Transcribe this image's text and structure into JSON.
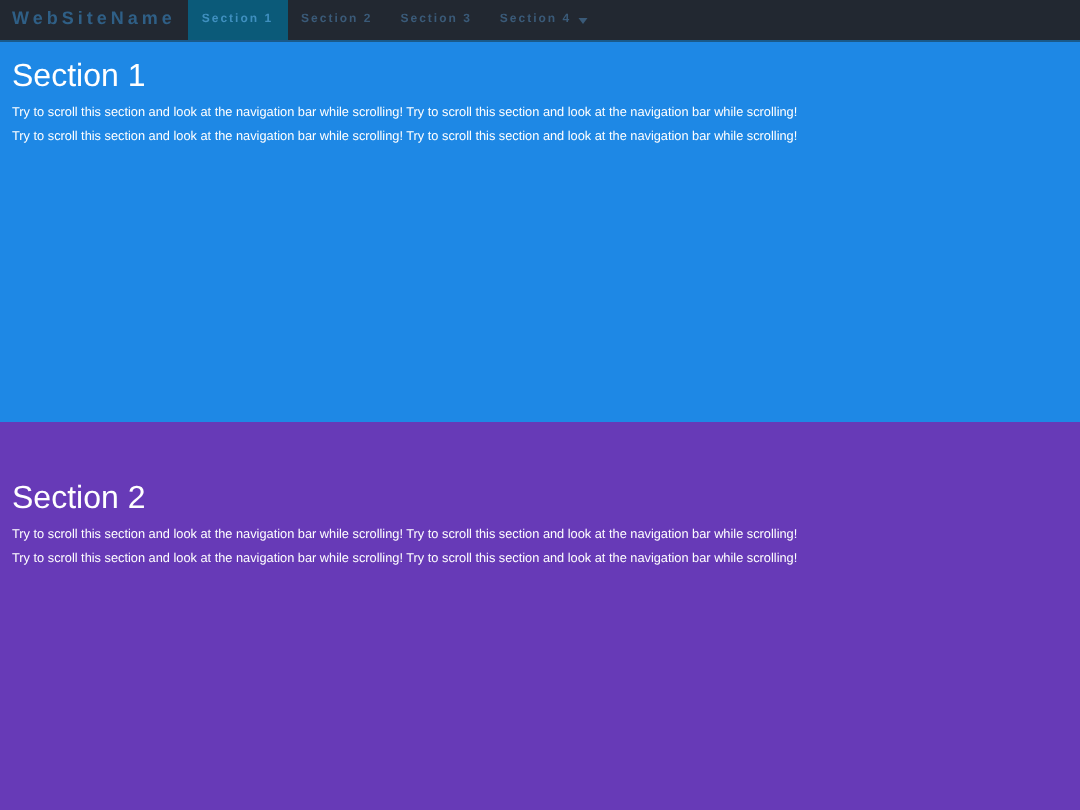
{
  "navbar": {
    "brand": "WebSiteName",
    "items": [
      {
        "label": "Section 1",
        "selected": true,
        "dropdown": false
      },
      {
        "label": "Section 2",
        "selected": false,
        "dropdown": false
      },
      {
        "label": "Section 3",
        "selected": false,
        "dropdown": false
      },
      {
        "label": "Section 4",
        "selected": false,
        "dropdown": true
      }
    ]
  },
  "sections": [
    {
      "title": "Section 1",
      "color": "#1e88e5",
      "paragraphs": [
        "Try to scroll this section and look at the navigation bar while scrolling! Try to scroll this section and look at the navigation bar while scrolling!",
        "Try to scroll this section and look at the navigation bar while scrolling! Try to scroll this section and look at the navigation bar while scrolling!"
      ]
    },
    {
      "title": "Section 2",
      "color": "#673ab7",
      "paragraphs": [
        "Try to scroll this section and look at the navigation bar while scrolling! Try to scroll this section and look at the navigation bar while scrolling!",
        "Try to scroll this section and look at the navigation bar while scrolling! Try to scroll this section and look at the navigation bar while scrolling!"
      ]
    }
  ]
}
